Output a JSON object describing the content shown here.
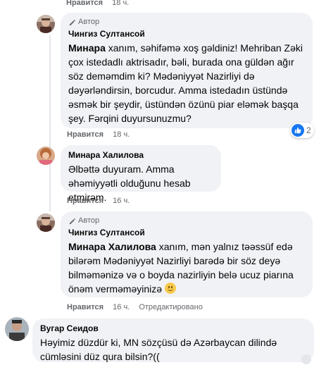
{
  "comments": [
    {
      "id": "top-partial",
      "like_label": "Нравится",
      "time": "18 ч."
    },
    {
      "id": "c1",
      "badge": "Автор",
      "author": "Чингиз Султансой",
      "mention": "Минара",
      "text": " xanım, səhifəmə xoş gəldiniz! Mehriban Zəki çox istedadlı aktrisadır, bəli, burada ona güldən ağır söz deməmdim ki? Mədəniyyət Nazirliyi də dəyərləndirsin, borcudur. Amma istedadın üstündə əsmək bir şeydir, üstündən özünü piar eləmək başqa şey. Fərqini duyursunuzmu?",
      "like_label": "Нравится",
      "time": "18 ч.",
      "reaction_count": "2"
    },
    {
      "id": "c2",
      "author": "Минара Халилова",
      "text": "Əlbəttə duyuram. Amma əhəmiyyətli olduğunu hesab etmirəm.",
      "like_label": "Нравится",
      "time": "16 ч."
    },
    {
      "id": "c3",
      "badge": "Автор",
      "author": "Чингиз Султансой",
      "mention": "Минара Халилова",
      "text": " xanım, mən yalnız təəssüf edə bilərəm Mədəniyyət Nazirliyi barədə bir söz deyə bilməmənizə və o boyda nazirliyin belə ucuz piarına önəm verməməyinizə",
      "like_label": "Нравится",
      "time": "16 ч.",
      "edited": "Отредактировано"
    },
    {
      "id": "c4",
      "author": "Вугар Сеидов",
      "text": "Həyimiz düzdür ki, MN sözçüsü də Azərbaycan dilində cümləsini düz qura bilsin?(("
    }
  ],
  "colors": {
    "bubble": "#f0f2f5",
    "meta": "#65676b",
    "like_blue": "#1877f2"
  }
}
